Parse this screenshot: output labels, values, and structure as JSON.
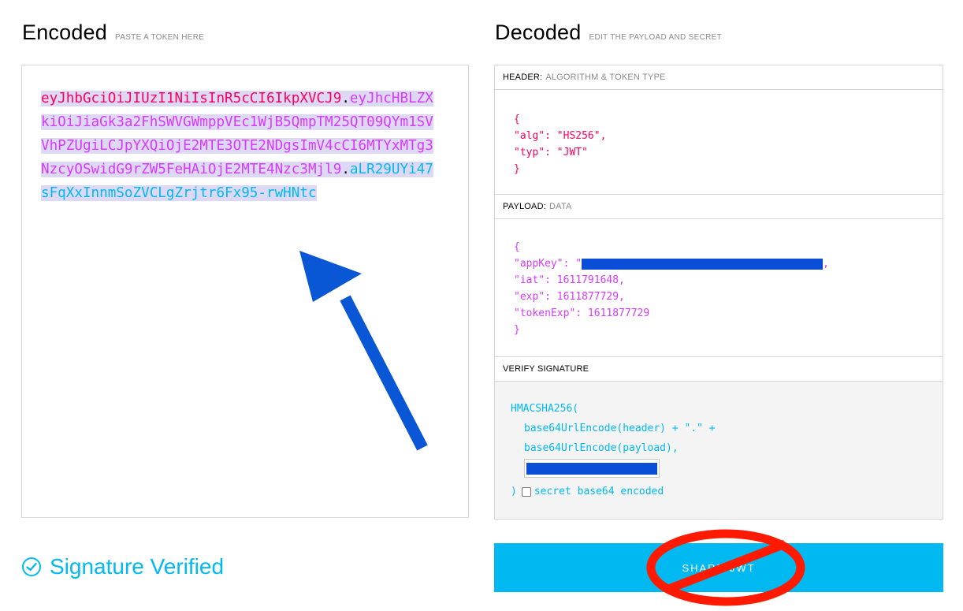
{
  "encoded": {
    "title": "Encoded",
    "subtitle": "PASTE A TOKEN HERE",
    "token_header": "eyJhbGciOiJIUzI1NiIsInR5cCI6IkpXVCJ9",
    "dot1": ".",
    "token_payload": "eyJhcHBLZXkiOiJiaGk3a2FhSWVGWmppVEc1WjB5QmpTM25QT09QYm1SVVhPZUgiLCJpYXQiOjE2MTE3OTE2NDgsImV4cCI6MTYxMTg3NzcyOSwidG9rZW5FeHAiOjE2MTE4Nzc3Mjl9",
    "dot2": ".",
    "token_signature": "aLR29UYi47sFqXxInnmSoZVCLgZrjtr6Fx95-rwHNtc"
  },
  "status": {
    "label": "Signature Verified",
    "icon": "check-circle-icon"
  },
  "decoded": {
    "title": "Decoded",
    "subtitle": "EDIT THE PAYLOAD AND SECRET",
    "header_section": {
      "label": "HEADER:",
      "sublabel": "ALGORITHM & TOKEN TYPE",
      "open": "{",
      "line1": "\"alg\": \"HS256\",",
      "line2": "\"typ\": \"JWT\"",
      "close": "}"
    },
    "payload_section": {
      "label": "PAYLOAD:",
      "sublabel": "DATA",
      "open": "{",
      "appkey_prefix": "\"appKey\": \"",
      "appkey_suffix": ",",
      "line_iat": "\"iat\": 1611791648,",
      "line_exp": "\"exp\": 1611877729,",
      "line_tokenexp": "\"tokenExp\": 1611877729",
      "close": "}"
    },
    "signature_section": {
      "label": "VERIFY SIGNATURE",
      "line1": "HMACSHA256(",
      "line2": "base64UrlEncode(header) + \".\" +",
      "line3": "base64UrlEncode(payload),",
      "close": ")",
      "checkbox_label": "secret base64 encoded"
    }
  },
  "share_button": {
    "label": "SHARE JWT"
  },
  "colors": {
    "header": "#fb015b",
    "payload": "#d63aff",
    "signature": "#00b9f1",
    "redaction": "#0a4ed8",
    "annotation_arrow": "#0a57d6",
    "annotation_noentry": "#ff1a00"
  }
}
